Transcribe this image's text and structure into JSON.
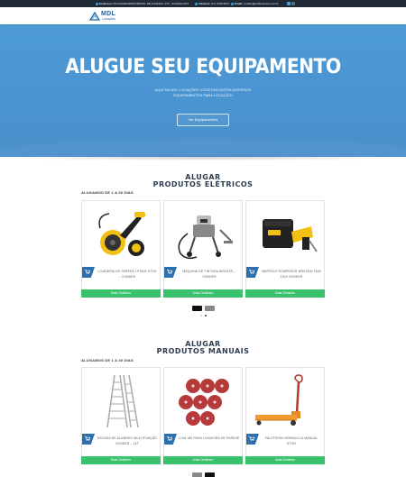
{
  "topbar": {
    "address_label": "Endereço:",
    "address_value": "RUA MARGARIDA BIRSAL DE ALMEIDA, 476 - GUARULHOS",
    "phone_label": "Telefone:",
    "phone_value": "(11) 2468-9673",
    "email_label": "Email:",
    "email_value": "contato@mdlocacoes.com.br"
  },
  "brand": {
    "name": "MDL",
    "tagline": "Locações"
  },
  "nav": {
    "home": "Home",
    "about": "Quem Somos",
    "equipment": "Todos Equipamentos"
  },
  "hero": {
    "title": "ALUGUE SEU EQUIPAMENTO",
    "subtitle": "AQUI NA MDL LOCAÇÕES VOCÊ ENCONTRA DIVERSOS EQUIPAMENTOS PARA LOCAÇÃO!",
    "cta": "Ver Equipamentos"
  },
  "sections": [
    {
      "title_line1": "ALUGAR",
      "title_line2": "PRODUTOS ELÉTRICOS",
      "subtitle": "ALUGAMOS DE 1 A 30 DIAS",
      "products": [
        {
          "name": "LIXADEIRA DE PAREDE LP1800 STI20 – VONDER",
          "button": "Mais Detalhes",
          "icon": "wall-sander-icon"
        },
        {
          "name": "MÁQUINA DE PINTURA AIRLESS – VONDER",
          "button": "Mais Detalhes",
          "icon": "airless-sprayer-icon"
        },
        {
          "name": "MARTELO ROMPEDOR MRV1500 1500 220V VONDER",
          "button": "Mais Detalhes",
          "icon": "demolition-hammer-icon"
        }
      ]
    },
    {
      "title_line1": "ALUGAR",
      "title_line2": "PRODUTOS MANUAIS",
      "subtitle": "ALUGAMOS DE 1 A 30 DIAS",
      "products": [
        {
          "name": "ESCADA DE ALUMÍNIO MULTIFUNÇÃO VONDER – 14T",
          "button": "Mais Detalhes",
          "icon": "aluminum-ladder-icon"
        },
        {
          "name": "LIXA 180 PARA LIXADEIRA DE PAREDE",
          "button": "Mais Detalhes",
          "icon": "sanding-discs-icon"
        },
        {
          "name": "PALETEIRA HIDRÁULICA MANUAL STON",
          "button": "Mais Detalhes",
          "icon": "pallet-jack-icon"
        }
      ]
    }
  ],
  "colors": {
    "hero": "#4a94d0",
    "accent_blue": "#2f6fae",
    "button_green": "#39c16c",
    "topbar": "#1f2a35"
  }
}
